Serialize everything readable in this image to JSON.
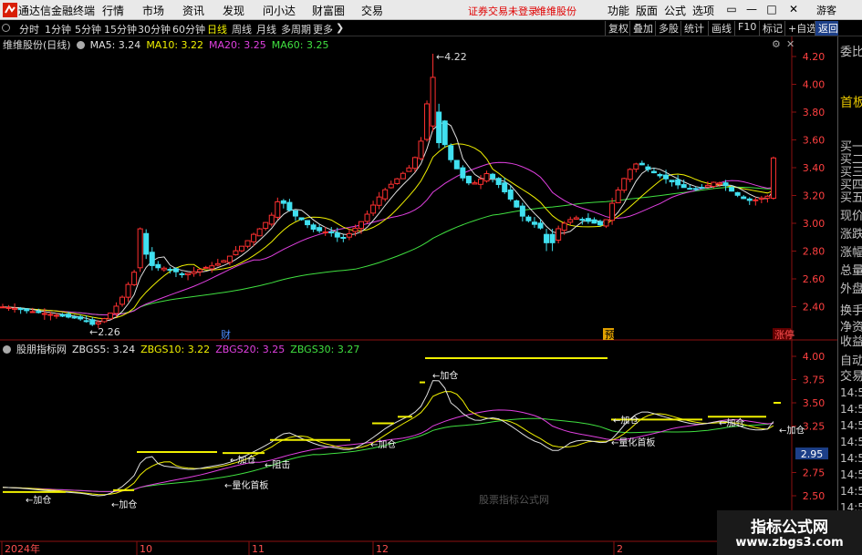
{
  "menubar": {
    "app_name": "通达信金融终端",
    "menu": [
      "行情",
      "市场",
      "资讯",
      "发现",
      "问小达",
      "财富圈",
      "交易"
    ],
    "login_status": "证券交易未登录",
    "stock_name": "维维股份",
    "right_menu": [
      "功能",
      "版面",
      "公式",
      "选项"
    ],
    "guest": "游客"
  },
  "toolbar": {
    "periods": [
      "分时",
      "1分钟",
      "5分钟",
      "15分钟",
      "30分钟",
      "60分钟",
      "日线",
      "周线",
      "月线",
      "多周期",
      "更多"
    ],
    "active_period": "日线",
    "right_buttons": [
      "复权",
      "叠加",
      "多股",
      "统计",
      "画线",
      "F10",
      "标记",
      "+自选",
      "返回"
    ]
  },
  "main_chart": {
    "title": "维维股份(日线)",
    "ma_labels": [
      {
        "text": "MA5: 3.24",
        "color": "#e0e0e0"
      },
      {
        "text": "MA10: 3.22",
        "color": "#f0f000"
      },
      {
        "text": "MA20: 3.25",
        "color": "#e040e0"
      },
      {
        "text": "MA60: 3.25",
        "color": "#40e040"
      }
    ],
    "y_ticks": [
      "4.20",
      "4.00",
      "3.80",
      "3.60",
      "3.40",
      "3.20",
      "3.00",
      "2.80",
      "2.60",
      "2.40"
    ],
    "y_values": [
      4.2,
      4.0,
      3.8,
      3.6,
      3.4,
      3.2,
      3.0,
      2.8,
      2.6,
      2.4
    ],
    "high_label": "4.22",
    "low_label": "2.26",
    "events": [
      {
        "text": "财",
        "color": "#4a8cff",
        "bg": "none"
      },
      {
        "text": "预",
        "color": "#000",
        "bg": "#e0a000"
      },
      {
        "text": "涨停",
        "color": "#ff5050",
        "bg": "#600000"
      }
    ]
  },
  "indicator": {
    "title": "股朋指标网",
    "labels": [
      {
        "text": "ZBGS5: 3.24",
        "color": "#e0e0e0"
      },
      {
        "text": "ZBGS10: 3.22",
        "color": "#f0f000"
      },
      {
        "text": "ZBGS20: 3.25",
        "color": "#e040e0"
      },
      {
        "text": "ZBGS30: 3.27",
        "color": "#40e040"
      }
    ],
    "y_ticks": [
      "4.00",
      "3.75",
      "3.50",
      "3.25",
      "2.75",
      "2.50"
    ],
    "y_values": [
      4.0,
      3.75,
      3.5,
      3.25,
      2.75,
      2.5
    ],
    "current_value": "2.95",
    "annotations": [
      "加仓",
      "加仓",
      "加仓",
      "阻击",
      "量化首板",
      "加仓",
      "加仓",
      "量化首板",
      "加仓",
      "加仓",
      "加仓"
    ],
    "watermark_text": "股票指标公式网"
  },
  "x_axis": [
    "2024年",
    "10",
    "11",
    "12",
    "2"
  ],
  "right_panel": {
    "items": [
      "委比",
      "首板",
      "买一",
      "买二",
      "买三",
      "买四",
      "买五",
      "现价",
      "涨跌",
      "涨幅",
      "总量",
      "外盘",
      "换手",
      "净资",
      "收益",
      "自动",
      "交易"
    ],
    "times": [
      "14:56",
      "14:56",
      "14:56",
      "14:56",
      "14:56",
      "14:56",
      "14:56",
      "14:56"
    ]
  },
  "site_watermark": {
    "line1": "指标公式网",
    "line2": "www.zbgs3.com"
  },
  "colors": {
    "up": "#ff3030",
    "down": "#40e0f0",
    "ma5": "#e0e0e0",
    "ma10": "#f0f000",
    "ma20": "#e040e0",
    "ma60": "#40e040"
  }
}
